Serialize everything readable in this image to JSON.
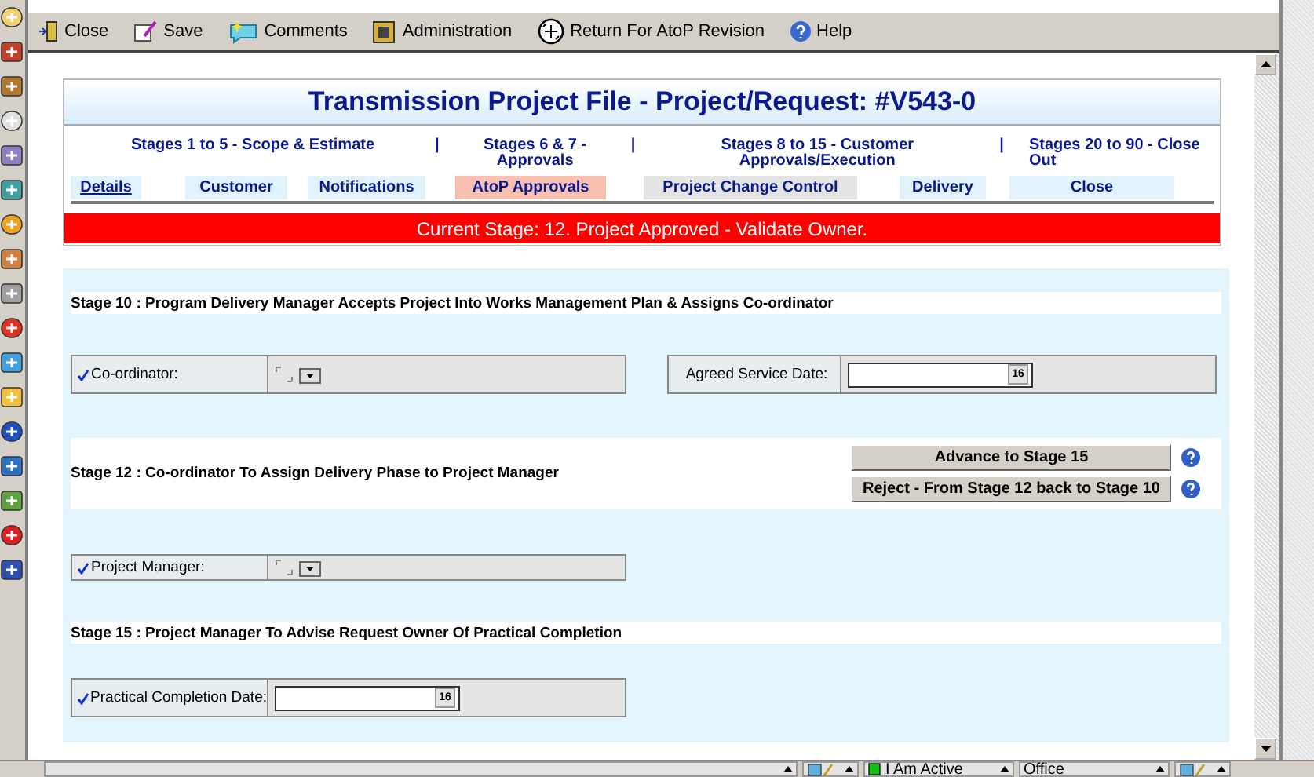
{
  "toolbar": [
    {
      "kind": "close",
      "label": "Close"
    },
    {
      "kind": "save",
      "label": "Save"
    },
    {
      "kind": "comments",
      "label": "Comments"
    },
    {
      "kind": "admin",
      "label": "Administration"
    },
    {
      "kind": "return",
      "label": "Return For AtoP Revision"
    },
    {
      "kind": "help",
      "label": "Help"
    }
  ],
  "title": "Transmission Project File - Project/Request: #V543-0",
  "stage_groups": [
    {
      "kind": "group",
      "label": "Stages 1 to 5 - Scope & Estimate"
    },
    {
      "kind": "separator",
      "label": "|"
    },
    {
      "kind": "group",
      "label": "Stages 6 & 7 - Approvals"
    },
    {
      "kind": "separator",
      "label": "|"
    },
    {
      "kind": "group",
      "label": "Stages 8 to 15 - Customer Approvals/Execution"
    },
    {
      "kind": "separator",
      "label": "|"
    },
    {
      "kind": "group",
      "label": "Stages 20 to 90 - Close Out"
    }
  ],
  "tabs": [
    {
      "label": "Details",
      "selected": false,
      "focused": true,
      "disabled": false
    },
    {
      "label": "Customer",
      "selected": false,
      "focused": false,
      "disabled": false
    },
    {
      "label": "Notifications",
      "selected": false,
      "focused": false,
      "disabled": false
    },
    {
      "label": "AtoP Approvals",
      "selected": true,
      "focused": false,
      "disabled": false
    },
    {
      "label": "Project Change Control",
      "selected": false,
      "focused": false,
      "disabled": true
    },
    {
      "label": "Delivery",
      "selected": false,
      "focused": false,
      "disabled": false
    },
    {
      "label": "Close",
      "selected": false,
      "focused": false,
      "disabled": false
    }
  ],
  "current_stage": "Current Stage: 12. Project Approved - Validate Owner.",
  "stages": [
    {
      "heading": "Stage 10 : Program Delivery Manager Accepts Project Into Works Management Plan & Assigns Co-ordinator",
      "fields": [
        {
          "kind": "dropdown",
          "label": "Co-ordinator:",
          "required": true
        },
        {
          "kind": "date",
          "label": "Agreed Service Date:",
          "required": false,
          "calendar": "16"
        }
      ]
    },
    {
      "heading": "Stage 12 : Co-ordinator To Assign Delivery Phase to Project Manager",
      "buttons": [
        "Advance to Stage 15",
        "Reject - From Stage 12 back to Stage 10"
      ],
      "fields": [
        {
          "kind": "dropdown",
          "label": "Project Manager:",
          "required": true
        }
      ]
    },
    {
      "heading": "Stage 15 : Project Manager To Advise Request Owner Of Practical Completion",
      "fields": [
        {
          "kind": "date",
          "label": "Practical Completion Date:",
          "required": true,
          "calendar": "16"
        }
      ]
    }
  ],
  "status_bar": [
    {
      "kind": "blank"
    },
    {
      "kind": "icon"
    },
    {
      "kind": "presence",
      "label": "I Am Active"
    },
    {
      "kind": "text",
      "label": "Office"
    },
    {
      "kind": "icon"
    }
  ]
}
